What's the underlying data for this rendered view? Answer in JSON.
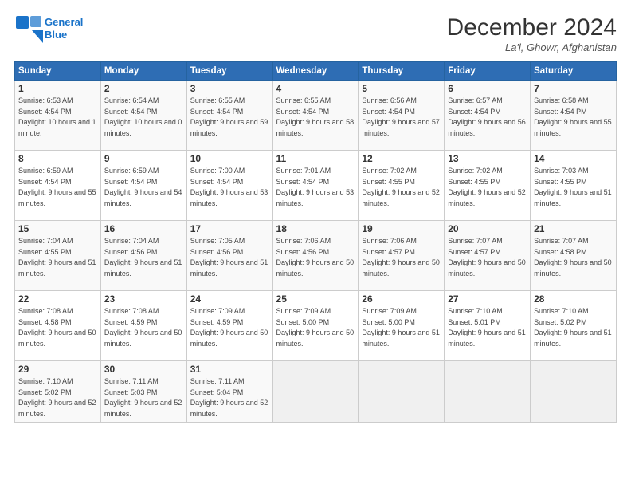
{
  "logo": {
    "line1": "General",
    "line2": "Blue"
  },
  "title": "December 2024",
  "subtitle": "La'l, Ghowr, Afghanistan",
  "weekdays": [
    "Sunday",
    "Monday",
    "Tuesday",
    "Wednesday",
    "Thursday",
    "Friday",
    "Saturday"
  ],
  "weeks": [
    [
      {
        "day": 1,
        "sunrise": "6:53 AM",
        "sunset": "4:54 PM",
        "daylight": "10 hours and 1 minute."
      },
      {
        "day": 2,
        "sunrise": "6:54 AM",
        "sunset": "4:54 PM",
        "daylight": "10 hours and 0 minutes."
      },
      {
        "day": 3,
        "sunrise": "6:55 AM",
        "sunset": "4:54 PM",
        "daylight": "9 hours and 59 minutes."
      },
      {
        "day": 4,
        "sunrise": "6:55 AM",
        "sunset": "4:54 PM",
        "daylight": "9 hours and 58 minutes."
      },
      {
        "day": 5,
        "sunrise": "6:56 AM",
        "sunset": "4:54 PM",
        "daylight": "9 hours and 57 minutes."
      },
      {
        "day": 6,
        "sunrise": "6:57 AM",
        "sunset": "4:54 PM",
        "daylight": "9 hours and 56 minutes."
      },
      {
        "day": 7,
        "sunrise": "6:58 AM",
        "sunset": "4:54 PM",
        "daylight": "9 hours and 55 minutes."
      }
    ],
    [
      {
        "day": 8,
        "sunrise": "6:59 AM",
        "sunset": "4:54 PM",
        "daylight": "9 hours and 55 minutes."
      },
      {
        "day": 9,
        "sunrise": "6:59 AM",
        "sunset": "4:54 PM",
        "daylight": "9 hours and 54 minutes."
      },
      {
        "day": 10,
        "sunrise": "7:00 AM",
        "sunset": "4:54 PM",
        "daylight": "9 hours and 53 minutes."
      },
      {
        "day": 11,
        "sunrise": "7:01 AM",
        "sunset": "4:54 PM",
        "daylight": "9 hours and 53 minutes."
      },
      {
        "day": 12,
        "sunrise": "7:02 AM",
        "sunset": "4:55 PM",
        "daylight": "9 hours and 52 minutes."
      },
      {
        "day": 13,
        "sunrise": "7:02 AM",
        "sunset": "4:55 PM",
        "daylight": "9 hours and 52 minutes."
      },
      {
        "day": 14,
        "sunrise": "7:03 AM",
        "sunset": "4:55 PM",
        "daylight": "9 hours and 51 minutes."
      }
    ],
    [
      {
        "day": 15,
        "sunrise": "7:04 AM",
        "sunset": "4:55 PM",
        "daylight": "9 hours and 51 minutes."
      },
      {
        "day": 16,
        "sunrise": "7:04 AM",
        "sunset": "4:56 PM",
        "daylight": "9 hours and 51 minutes."
      },
      {
        "day": 17,
        "sunrise": "7:05 AM",
        "sunset": "4:56 PM",
        "daylight": "9 hours and 51 minutes."
      },
      {
        "day": 18,
        "sunrise": "7:06 AM",
        "sunset": "4:56 PM",
        "daylight": "9 hours and 50 minutes."
      },
      {
        "day": 19,
        "sunrise": "7:06 AM",
        "sunset": "4:57 PM",
        "daylight": "9 hours and 50 minutes."
      },
      {
        "day": 20,
        "sunrise": "7:07 AM",
        "sunset": "4:57 PM",
        "daylight": "9 hours and 50 minutes."
      },
      {
        "day": 21,
        "sunrise": "7:07 AM",
        "sunset": "4:58 PM",
        "daylight": "9 hours and 50 minutes."
      }
    ],
    [
      {
        "day": 22,
        "sunrise": "7:08 AM",
        "sunset": "4:58 PM",
        "daylight": "9 hours and 50 minutes."
      },
      {
        "day": 23,
        "sunrise": "7:08 AM",
        "sunset": "4:59 PM",
        "daylight": "9 hours and 50 minutes."
      },
      {
        "day": 24,
        "sunrise": "7:09 AM",
        "sunset": "4:59 PM",
        "daylight": "9 hours and 50 minutes."
      },
      {
        "day": 25,
        "sunrise": "7:09 AM",
        "sunset": "5:00 PM",
        "daylight": "9 hours and 50 minutes."
      },
      {
        "day": 26,
        "sunrise": "7:09 AM",
        "sunset": "5:00 PM",
        "daylight": "9 hours and 51 minutes."
      },
      {
        "day": 27,
        "sunrise": "7:10 AM",
        "sunset": "5:01 PM",
        "daylight": "9 hours and 51 minutes."
      },
      {
        "day": 28,
        "sunrise": "7:10 AM",
        "sunset": "5:02 PM",
        "daylight": "9 hours and 51 minutes."
      }
    ],
    [
      {
        "day": 29,
        "sunrise": "7:10 AM",
        "sunset": "5:02 PM",
        "daylight": "9 hours and 52 minutes."
      },
      {
        "day": 30,
        "sunrise": "7:11 AM",
        "sunset": "5:03 PM",
        "daylight": "9 hours and 52 minutes."
      },
      {
        "day": 31,
        "sunrise": "7:11 AM",
        "sunset": "5:04 PM",
        "daylight": "9 hours and 52 minutes."
      },
      null,
      null,
      null,
      null
    ]
  ]
}
